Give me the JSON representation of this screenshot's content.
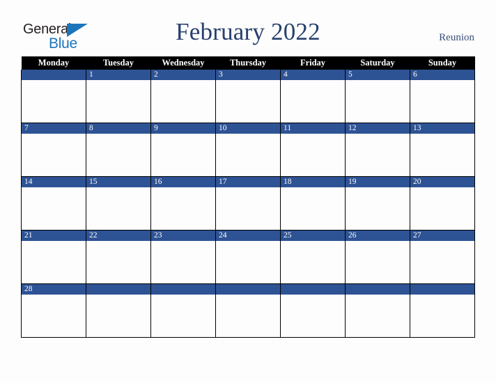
{
  "header": {
    "logo": {
      "line1": "General",
      "line2": "Blue",
      "triangle_color": "#1b75bc",
      "line1_color": "#231f20",
      "line2_color": "#1b75bc"
    },
    "title": "February 2022",
    "country": "Reunion"
  },
  "calendar": {
    "accent_color": "#2e5395",
    "header_bg": "#000000",
    "header_text_color": "#ffffff",
    "weekday_headers": [
      "Monday",
      "Tuesday",
      "Wednesday",
      "Thursday",
      "Friday",
      "Saturday",
      "Sunday"
    ],
    "weeks": [
      [
        "",
        "1",
        "2",
        "3",
        "4",
        "5",
        "6"
      ],
      [
        "7",
        "8",
        "9",
        "10",
        "11",
        "12",
        "13"
      ],
      [
        "14",
        "15",
        "16",
        "17",
        "18",
        "19",
        "20"
      ],
      [
        "21",
        "22",
        "23",
        "24",
        "25",
        "26",
        "27"
      ],
      [
        "28",
        "",
        "",
        "",
        "",
        "",
        ""
      ]
    ]
  }
}
